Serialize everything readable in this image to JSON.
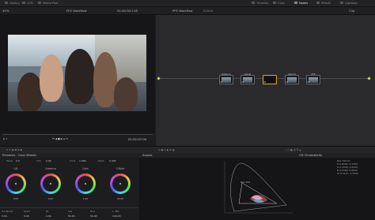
{
  "topbar": {
    "left_items": [
      "Gallery",
      "LUTs",
      "Media Pool"
    ],
    "right_items": [
      "Timeline",
      "Clips",
      "Nodes",
      "Effects",
      "Lightbox"
    ]
  },
  "viewer_header": {
    "zoom": "45%",
    "project": "PFE Workflow",
    "timecode": "01:00:30:11",
    "right_title": "PFE Workflow",
    "right_status": "Edited",
    "clip_label": "Clip"
  },
  "viewer": {
    "timecode_display": "01:02:07:05"
  },
  "nodes": [
    {
      "label": "Balance",
      "num": "01"
    },
    {
      "label": "Grade",
      "num": "02"
    },
    {
      "label": "",
      "num": "03"
    },
    {
      "label": "ALN T2",
      "num": "04"
    },
    {
      "label": "PFE",
      "num": "05"
    }
  ],
  "color_panel": {
    "title": "Primaries - Color Wheels",
    "params": [
      "Temp",
      "Tint",
      "Cont",
      "Pivot"
    ],
    "param_values": [
      "0.0",
      "0.00",
      "1.000",
      "0.435"
    ],
    "wheels": [
      {
        "label": "Lift",
        "values": [
          "0.00",
          "0.00",
          "0.00",
          "0.00"
        ]
      },
      {
        "label": "Gamma",
        "values": [
          "0.00",
          "0.00",
          "0.00",
          "0.00"
        ]
      },
      {
        "label": "Gain",
        "values": [
          "1.00",
          "1.00",
          "1.00",
          "1.00"
        ]
      },
      {
        "label": "Offset",
        "values": [
          "25.00",
          "25.00",
          "25.00"
        ]
      }
    ],
    "bottom_labels": [
      "Col Boost",
      "Shad",
      "HL",
      "Sat",
      "Hue",
      "L. Mix"
    ],
    "bottom_values": [
      "0.00",
      "0.00",
      "0.00",
      "50.00",
      "50.00",
      "100.00"
    ]
  },
  "scopes": {
    "title": "Scopes",
    "mode": "CIE Chromaticity",
    "gamut_label": "Rec.709",
    "info_lines": [
      "Rec.709 (F)",
      "R 0.6400, 0.3300",
      "G 0.3000, 0.6000",
      "B 0.1500, 0.0600",
      "W 0.3127, 0.3290"
    ]
  },
  "colors": {
    "background": "#1b1b1d",
    "panel": "#1d1d20",
    "accent": "#d8a33a"
  }
}
